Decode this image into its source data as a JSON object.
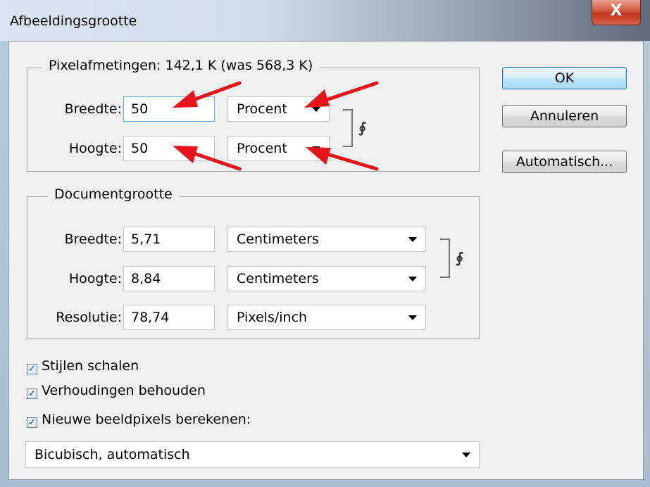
{
  "window": {
    "title": "Afbeeldingsgrootte",
    "close_label": "X"
  },
  "pixel_dimensions": {
    "legend": "Pixelafmetingen:  142,1 K (was 568,3 K)",
    "width_label": "Breedte:",
    "width_value": "50",
    "width_unit": "Procent",
    "height_label": "Hoogte:",
    "height_value": "50",
    "height_unit": "Procent",
    "link_icon": "chain-link-icon"
  },
  "document_size": {
    "legend": "Documentgrootte",
    "width_label": "Breedte:",
    "width_value": "5,71",
    "width_unit": "Centimeters",
    "height_label": "Hoogte:",
    "height_value": "8,84",
    "height_unit": "Centimeters",
    "resolution_label": "Resolutie:",
    "resolution_value": "78,74",
    "resolution_unit": "Pixels/inch",
    "link_icon": "chain-link-icon"
  },
  "buttons": {
    "ok": "OK",
    "cancel": "Annuleren",
    "auto": "Automatisch..."
  },
  "checkboxes": [
    {
      "label": "Stijlen schalen",
      "checked": true
    },
    {
      "label": "Verhoudingen behouden",
      "checked": true
    },
    {
      "label": "Nieuwe beeldpixels berekenen:",
      "checked": true
    }
  ],
  "resample_method": "Bicubisch, automatisch",
  "annotation": {
    "arrow_color": "#e8141a"
  }
}
